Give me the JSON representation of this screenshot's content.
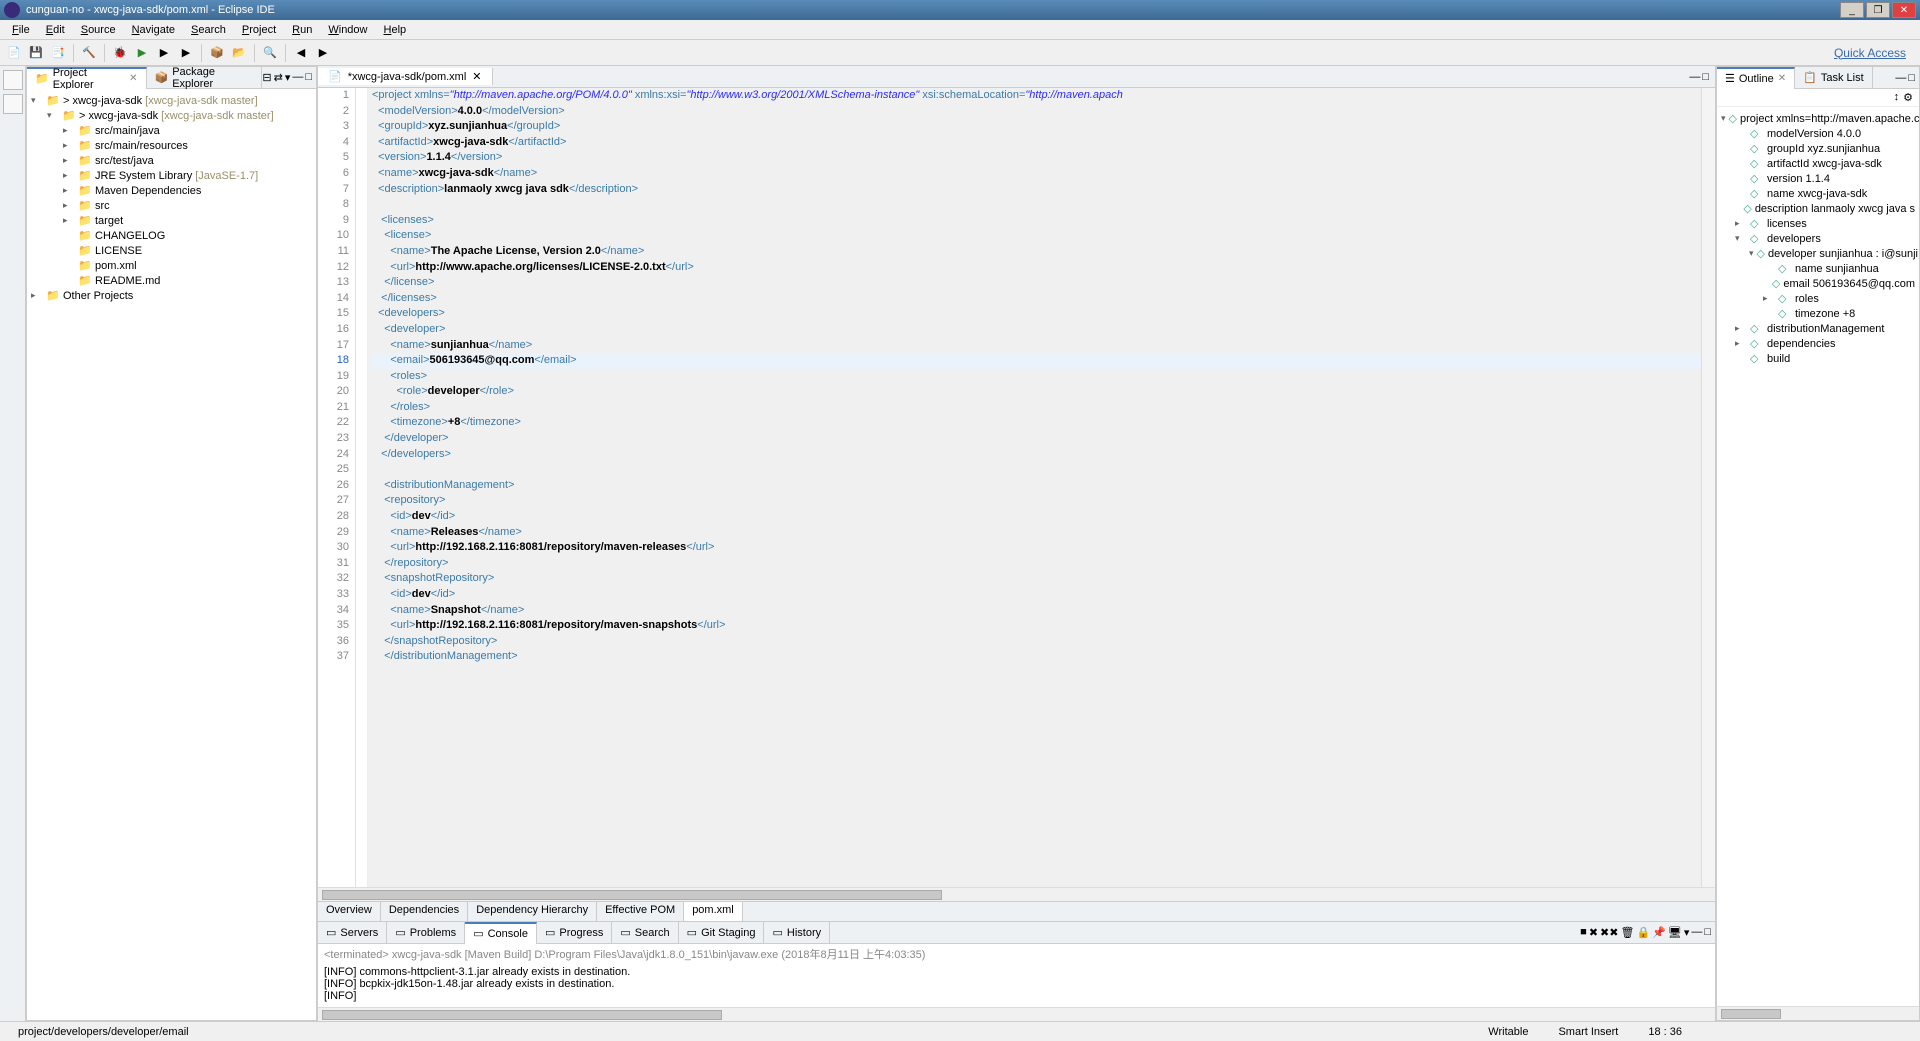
{
  "window": {
    "title": "cunguan-no - xwcg-java-sdk/pom.xml - Eclipse IDE"
  },
  "menus": [
    "File",
    "Edit",
    "Source",
    "Navigate",
    "Search",
    "Project",
    "Run",
    "Window",
    "Help"
  ],
  "quick_access": "Quick Access",
  "explorer": {
    "tab_active": "Project Explorer",
    "tab_inactive": "Package Explorer",
    "items": [
      {
        "d": 0,
        "exp": "▾",
        "label": "> xwcg-java-sdk",
        "deco": " [xwcg-java-sdk master]"
      },
      {
        "d": 1,
        "exp": "▾",
        "label": "> xwcg-java-sdk",
        "deco": " [xwcg-java-sdk master]"
      },
      {
        "d": 2,
        "exp": "▸",
        "label": "src/main/java"
      },
      {
        "d": 2,
        "exp": "▸",
        "label": "src/main/resources"
      },
      {
        "d": 2,
        "exp": "▸",
        "label": "src/test/java"
      },
      {
        "d": 2,
        "exp": "▸",
        "label": "JRE System Library",
        "deco": " [JavaSE-1.7]"
      },
      {
        "d": 2,
        "exp": "▸",
        "label": "Maven Dependencies"
      },
      {
        "d": 2,
        "exp": "▸",
        "label": "src"
      },
      {
        "d": 2,
        "exp": "▸",
        "label": "target"
      },
      {
        "d": 2,
        "exp": " ",
        "label": "CHANGELOG"
      },
      {
        "d": 2,
        "exp": " ",
        "label": "LICENSE"
      },
      {
        "d": 2,
        "exp": " ",
        "label": "pom.xml"
      },
      {
        "d": 2,
        "exp": " ",
        "label": "README.md"
      },
      {
        "d": 0,
        "exp": "▸",
        "label": "Other Projects"
      }
    ]
  },
  "editor": {
    "tab": "*xwcg-java-sdk/pom.xml",
    "active_line": 18,
    "lines": [
      {
        "n": 1,
        "h": "<span class='tag'>&lt;project</span> <span class='tag'>xmlns=</span><span class='av'>\"http://maven.apache.org/POM/4.0.0\"</span> <span class='tag'>xmlns:xsi=</span><span class='av'>\"http://www.w3.org/2001/XMLSchema-instance\"</span> <span class='tag'>xsi:schemaLocation=</span><span class='av'>\"http://maven.apach</span>"
      },
      {
        "n": 2,
        "h": "  <span class='tag'>&lt;modelVersion&gt;</span><span class='txt'>4.0.0</span><span class='tag'>&lt;/modelVersion&gt;</span>"
      },
      {
        "n": 3,
        "h": "  <span class='tag'>&lt;groupId&gt;</span><span class='txt'>xyz.sunjianhua</span><span class='tag'>&lt;/groupId&gt;</span>"
      },
      {
        "n": 4,
        "h": "  <span class='tag'>&lt;artifactId&gt;</span><span class='txt'>xwcg-java-sdk</span><span class='tag'>&lt;/artifactId&gt;</span>"
      },
      {
        "n": 5,
        "h": "  <span class='tag'>&lt;version&gt;</span><span class='txt'>1.1.4</span><span class='tag'>&lt;/version&gt;</span>"
      },
      {
        "n": 6,
        "h": "  <span class='tag'>&lt;name&gt;</span><span class='txt'>xwcg-java-sdk</span><span class='tag'>&lt;/name&gt;</span>"
      },
      {
        "n": 7,
        "h": "  <span class='tag'>&lt;description&gt;</span><span class='txt'>lanmaoly xwcg java sdk</span><span class='tag'>&lt;/description&gt;</span>"
      },
      {
        "n": 8,
        "h": ""
      },
      {
        "n": 9,
        "h": "   <span class='tag'>&lt;licenses&gt;</span>"
      },
      {
        "n": 10,
        "h": "    <span class='tag'>&lt;license&gt;</span>"
      },
      {
        "n": 11,
        "h": "      <span class='tag'>&lt;name&gt;</span><span class='txt'>The Apache License, Version 2.0</span><span class='tag'>&lt;/name&gt;</span>"
      },
      {
        "n": 12,
        "h": "      <span class='tag'>&lt;url&gt;</span><span class='txt'>http://www.apache.org/licenses/LICENSE-2.0.txt</span><span class='tag'>&lt;/url&gt;</span>"
      },
      {
        "n": 13,
        "h": "    <span class='tag'>&lt;/license&gt;</span>"
      },
      {
        "n": 14,
        "h": "   <span class='tag'>&lt;/licenses&gt;</span>"
      },
      {
        "n": 15,
        "h": "  <span class='tag'>&lt;developers&gt;</span>"
      },
      {
        "n": 16,
        "h": "    <span class='tag'>&lt;developer&gt;</span>"
      },
      {
        "n": 17,
        "h": "      <span class='tag'>&lt;name&gt;</span><span class='txt'>sunjianhua</span><span class='tag'>&lt;/name&gt;</span>"
      },
      {
        "n": 18,
        "h": "      <span class='tag'>&lt;email&gt;</span><span class='txt'>506193645@qq.com</span><span class='tag'>&lt;/email&gt;</span>"
      },
      {
        "n": 19,
        "h": "      <span class='tag'>&lt;roles&gt;</span>"
      },
      {
        "n": 20,
        "h": "        <span class='tag'>&lt;role&gt;</span><span class='txt'>developer</span><span class='tag'>&lt;/role&gt;</span>"
      },
      {
        "n": 21,
        "h": "      <span class='tag'>&lt;/roles&gt;</span>"
      },
      {
        "n": 22,
        "h": "      <span class='tag'>&lt;timezone&gt;</span><span class='txt'>+8</span><span class='tag'>&lt;/timezone&gt;</span>"
      },
      {
        "n": 23,
        "h": "    <span class='tag'>&lt;/developer&gt;</span>"
      },
      {
        "n": 24,
        "h": "   <span class='tag'>&lt;/developers&gt;</span>"
      },
      {
        "n": 25,
        "h": ""
      },
      {
        "n": 26,
        "h": "    <span class='tag'>&lt;distributionManagement&gt;</span>"
      },
      {
        "n": 27,
        "h": "    <span class='tag'>&lt;repository&gt;</span>"
      },
      {
        "n": 28,
        "h": "      <span class='tag'>&lt;id&gt;</span><span class='txt'>dev</span><span class='tag'>&lt;/id&gt;</span>"
      },
      {
        "n": 29,
        "h": "      <span class='tag'>&lt;name&gt;</span><span class='txt'>Releases</span><span class='tag'>&lt;/name&gt;</span>"
      },
      {
        "n": 30,
        "h": "      <span class='tag'>&lt;url&gt;</span><span class='txt'>http://192.168.2.116:8081/repository/maven-releases</span><span class='tag'>&lt;/url&gt;</span>"
      },
      {
        "n": 31,
        "h": "    <span class='tag'>&lt;/repository&gt;</span>"
      },
      {
        "n": 32,
        "h": "    <span class='tag'>&lt;snapshotRepository&gt;</span>"
      },
      {
        "n": 33,
        "h": "      <span class='tag'>&lt;id&gt;</span><span class='txt'>dev</span><span class='tag'>&lt;/id&gt;</span>"
      },
      {
        "n": 34,
        "h": "      <span class='tag'>&lt;name&gt;</span><span class='txt'>Snapshot</span><span class='tag'>&lt;/name&gt;</span>"
      },
      {
        "n": 35,
        "h": "      <span class='tag'>&lt;url&gt;</span><span class='txt'>http://192.168.2.116:8081/repository/maven-snapshots</span><span class='tag'>&lt;/url&gt;</span>"
      },
      {
        "n": 36,
        "h": "    <span class='tag'>&lt;/snapshotRepository&gt;</span>"
      },
      {
        "n": 37,
        "h": "    <span class='tag'>&lt;/distributionManagement&gt;</span>"
      }
    ],
    "bottom_tabs": [
      "Overview",
      "Dependencies",
      "Dependency Hierarchy",
      "Effective POM",
      "pom.xml"
    ],
    "bottom_active": "pom.xml"
  },
  "outline": {
    "tab_active": "Outline",
    "tab_inactive": "Task List",
    "items": [
      {
        "d": 0,
        "exp": "▾",
        "label": "project xmlns=http://maven.apache.c"
      },
      {
        "d": 1,
        "exp": " ",
        "label": "modelVersion  4.0.0"
      },
      {
        "d": 1,
        "exp": " ",
        "label": "groupId  xyz.sunjianhua"
      },
      {
        "d": 1,
        "exp": " ",
        "label": "artifactId  xwcg-java-sdk"
      },
      {
        "d": 1,
        "exp": " ",
        "label": "version  1.1.4"
      },
      {
        "d": 1,
        "exp": " ",
        "label": "name  xwcg-java-sdk"
      },
      {
        "d": 1,
        "exp": " ",
        "label": "description  lanmaoly xwcg java s"
      },
      {
        "d": 1,
        "exp": "▸",
        "label": "licenses"
      },
      {
        "d": 1,
        "exp": "▾",
        "label": "developers"
      },
      {
        "d": 2,
        "exp": "▾",
        "label": "developer  sunjianhua : i@sunji"
      },
      {
        "d": 3,
        "exp": " ",
        "label": "name  sunjianhua"
      },
      {
        "d": 3,
        "exp": " ",
        "label": "email  506193645@qq.com"
      },
      {
        "d": 3,
        "exp": "▸",
        "label": "roles"
      },
      {
        "d": 3,
        "exp": " ",
        "label": "timezone  +8"
      },
      {
        "d": 1,
        "exp": "▸",
        "label": "distributionManagement"
      },
      {
        "d": 1,
        "exp": "▸",
        "label": "dependencies"
      },
      {
        "d": 1,
        "exp": " ",
        "label": "build"
      }
    ]
  },
  "bottom_panel": {
    "tabs": [
      "Servers",
      "Problems",
      "Console",
      "Progress",
      "Search",
      "Git Staging",
      "History"
    ],
    "active": "Console",
    "header": "<terminated> xwcg-java-sdk [Maven Build] D:\\Program Files\\Java\\jdk1.8.0_151\\bin\\javaw.exe (2018年8月11日 上午4:03:35)",
    "lines": [
      "[INFO] commons-httpclient-3.1.jar already exists in destination.",
      "[INFO] bcpkix-jdk15on-1.48.jar already exists in destination.",
      "[INFO]"
    ]
  },
  "status": {
    "path": "project/developers/developer/email",
    "writable": "Writable",
    "insert": "Smart Insert",
    "pos": "18 : 36"
  }
}
